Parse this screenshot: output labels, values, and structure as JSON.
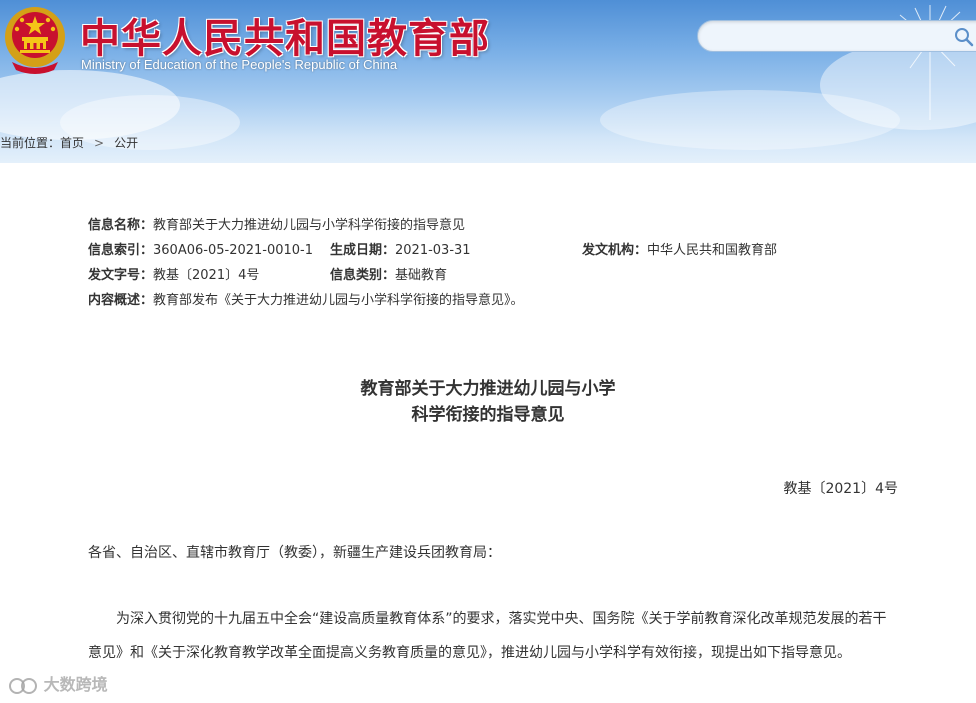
{
  "header": {
    "title_cn": "中华人民共和国教育部",
    "title_en": "Ministry of Education of the People's Republic of China",
    "search_placeholder": "",
    "colors": {
      "title": "#c8102e",
      "sky_top": "#4f8fd6",
      "sky_bottom": "#e4f0fb"
    }
  },
  "breadcrumb": {
    "prefix": "当前位置：",
    "items": [
      "首页",
      "公开"
    ],
    "separator": ">"
  },
  "info": {
    "name_label": "信息名称：",
    "name_value": "教育部关于大力推进幼儿园与小学科学衔接的指导意见",
    "index_label": "信息索引：",
    "index_value": "360A06-05-2021-0010-1",
    "date_label": "生成日期：",
    "date_value": "2021-03-31",
    "org_label": "发文机构：",
    "org_value": "中华人民共和国教育部",
    "docno_label": "发文字号：",
    "docno_value": "教基〔2021〕4号",
    "category_label": "信息类别：",
    "category_value": "基础教育",
    "summary_label": "内容概述：",
    "summary_value": "教育部发布《关于大力推进幼儿园与小学科学衔接的指导意见》。"
  },
  "article": {
    "title_line1": "教育部关于大力推进幼儿园与小学",
    "title_line2": "科学衔接的指导意见",
    "doc_number": "教基〔2021〕4号",
    "salutation": "各省、自治区、直辖市教育厅（教委），新疆生产建设兵团教育局：",
    "paragraph1": "为深入贯彻党的十九届五中全会“建设高质量教育体系”的要求，落实党中央、国务院《关于学前教育深化改革规范发展的若干意见》和《关于深化教育教学改革全面提高义务教育质量的意见》，推进幼儿园与小学科学有效衔接，现提出如下指导意见。"
  },
  "watermark": "大数跨境"
}
